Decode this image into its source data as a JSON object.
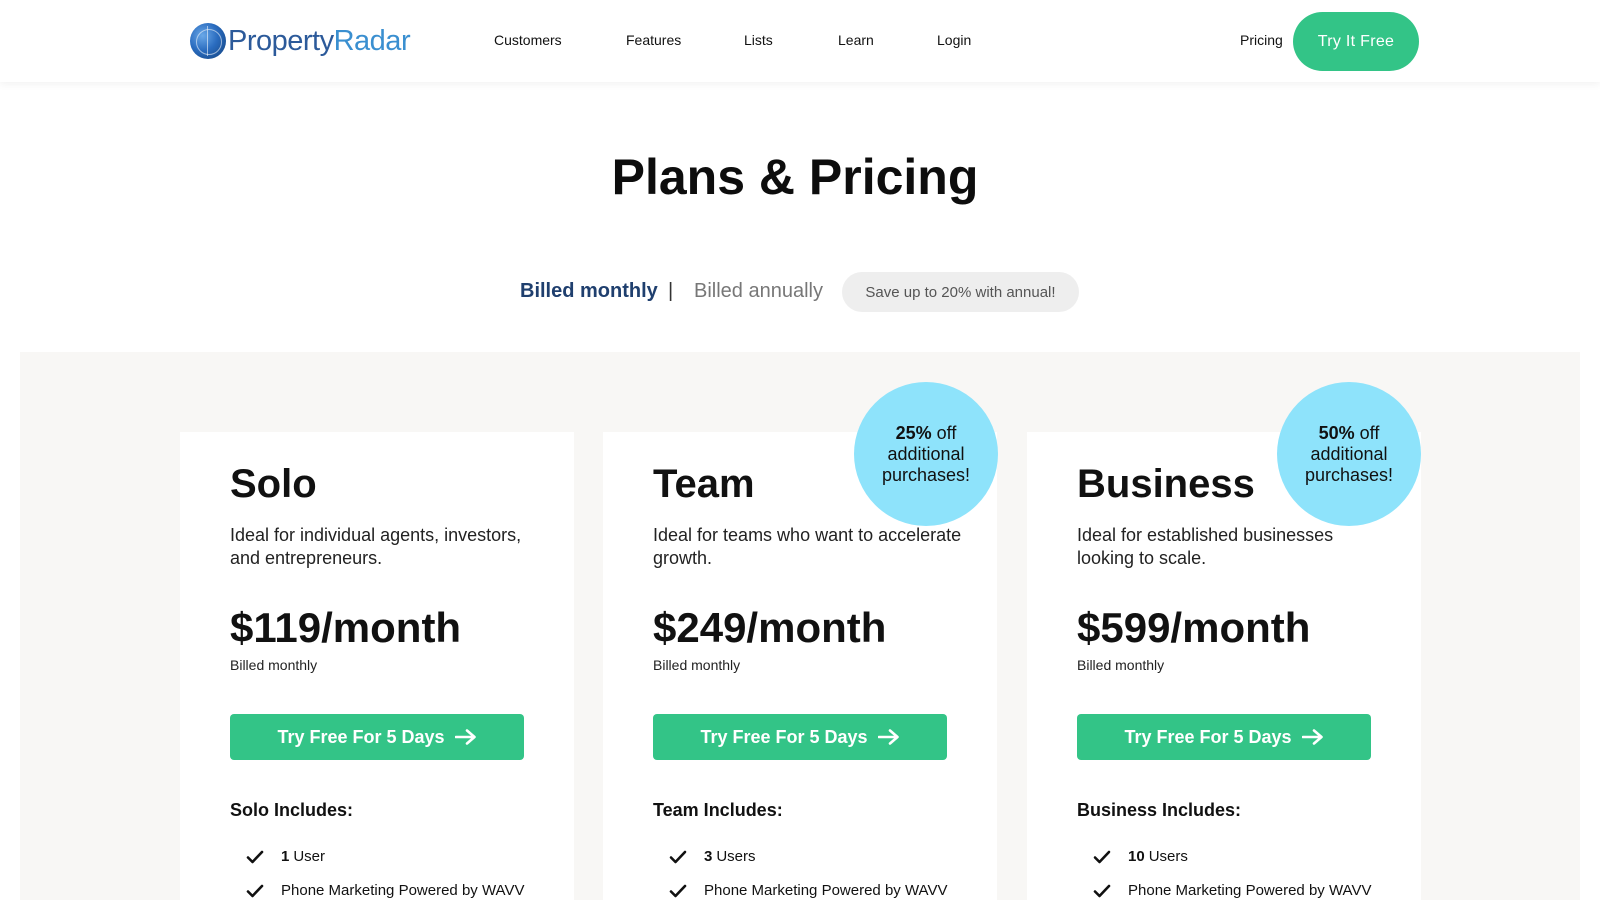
{
  "header": {
    "logo_part1": "Property",
    "logo_part2": "Radar",
    "nav": [
      "Customers",
      "Features",
      "Lists",
      "Learn",
      "Login"
    ],
    "pricing_label": "Pricing",
    "cta_label": "Try It Free"
  },
  "page_title": "Plans & Pricing",
  "billing": {
    "monthly_label": "Billed monthly",
    "separator": "|",
    "annual_label": "Billed annually",
    "save_badge": "Save up to 20% with annual!"
  },
  "plans": [
    {
      "name": "Solo",
      "description": "Ideal for individual agents, investors, and entrepreneurs.",
      "price": "$119/month",
      "billed": "Billed monthly",
      "cta": "Try Free For 5 Days",
      "includes_title": "Solo Includes:",
      "features": [
        {
          "bold": "1",
          "text": "User"
        },
        {
          "bold": "",
          "text": "Phone Marketing Powered by WAVV"
        }
      ]
    },
    {
      "name": "Team",
      "description": "Ideal for teams who want to accelerate growth.",
      "price": "$249/month",
      "billed": "Billed monthly",
      "cta": "Try Free For 5 Days",
      "includes_title": "Team Includes:",
      "discount": {
        "bold": "25%",
        "rest": "off",
        "line2": "additional",
        "line3": "purchases!"
      },
      "features": [
        {
          "bold": "3",
          "text": "Users"
        },
        {
          "bold": "",
          "text": "Phone Marketing Powered by WAVV"
        }
      ]
    },
    {
      "name": "Business",
      "description": "Ideal for established businesses looking to scale.",
      "price": "$599/month",
      "billed": "Billed monthly",
      "cta": "Try Free For 5 Days",
      "includes_title": "Business Includes:",
      "discount": {
        "bold": "50%",
        "rest": "off",
        "line2": "additional",
        "line3": "purchases!"
      },
      "features": [
        {
          "bold": "10",
          "text": "Users"
        },
        {
          "bold": "",
          "text": "Phone Marketing Powered by WAVV"
        }
      ]
    }
  ],
  "colors": {
    "accent_green": "#33c487",
    "brand_blue": "#1f3f6e",
    "badge_cyan": "#8ee3fb",
    "section_bg": "#f8f7f5"
  }
}
